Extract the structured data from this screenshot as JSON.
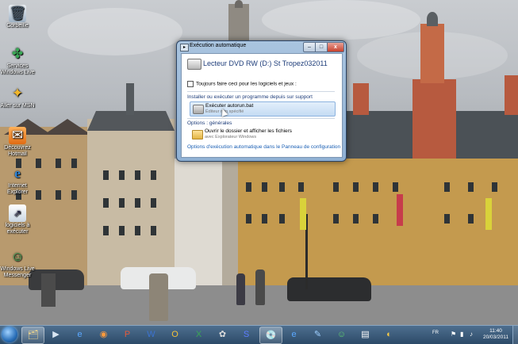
{
  "desktop": {
    "icons": [
      {
        "label": "Corbeille",
        "icon": "recycle-bin-icon"
      },
      {
        "label": "Services Windows Live",
        "icon": "windows-live-services-icon"
      },
      {
        "label": "Aller sur MSN",
        "icon": "msn-butterfly-icon"
      },
      {
        "label": "Découvrez Hotmail",
        "icon": "hotmail-icon"
      },
      {
        "label": "Internet Explorer",
        "icon": "internet-explorer-icon"
      },
      {
        "label": "logiciels à exécuter",
        "icon": "folder-shortcut-icon"
      },
      {
        "label": "Windows Live Messenger",
        "icon": "messenger-icon"
      }
    ]
  },
  "dialog": {
    "title": "Exécution automatique",
    "drive_title": "Lecteur DVD RW (D:) St Tropez032011",
    "always_checkbox_label": "Toujours faire ceci pour les logiciels et jeux :",
    "section_install": "Installer ou exécuter un programme depuis sur support",
    "option_run_main": "Exécuter autorun.bat",
    "option_run_sub": "Éditeur non spécifié",
    "section_general": "Options : générales",
    "option_folder_main": "Ouvrir le dossier et afficher les fichiers",
    "option_folder_sub": "avec Explorateur Windows",
    "control_panel_link": "Options d'exécution automatique dans le Panneau de configuration",
    "minimize_glyph": "–",
    "maximize_glyph": "□",
    "close_glyph": "x"
  },
  "taskbar": {
    "items": [
      {
        "icon": "windows-explorer-icon",
        "glyph": "🗂",
        "active": true
      },
      {
        "icon": "media-player-icon",
        "glyph": "▶",
        "active": false
      },
      {
        "icon": "internet-explorer-icon",
        "glyph": "e",
        "active": false
      },
      {
        "icon": "firefox-icon",
        "glyph": "◉",
        "active": false
      },
      {
        "icon": "powerpoint-icon",
        "glyph": "P",
        "active": false
      },
      {
        "icon": "word-icon",
        "glyph": "W",
        "active": false
      },
      {
        "icon": "outlook-icon",
        "glyph": "O",
        "active": false
      },
      {
        "icon": "excel-icon",
        "glyph": "X",
        "active": false
      },
      {
        "icon": "app-icon",
        "glyph": "✿",
        "active": false
      },
      {
        "icon": "security-icon",
        "glyph": "S",
        "active": false
      },
      {
        "icon": "autoplay-window-icon",
        "glyph": "💿",
        "active": true
      },
      {
        "icon": "internet-explorer-2-icon",
        "glyph": "e",
        "active": false
      },
      {
        "icon": "paint-icon",
        "glyph": "✎",
        "active": false
      },
      {
        "icon": "messenger-icon",
        "glyph": "☺",
        "active": false
      },
      {
        "icon": "document-icon",
        "glyph": "▤",
        "active": false
      },
      {
        "icon": "chat-icon",
        "glyph": "◐",
        "active": false
      }
    ],
    "language": "FR",
    "clock_time": "11:40",
    "clock_date": "20/03/2011",
    "tray_icons": [
      "flag-icon",
      "network-icon",
      "volume-icon"
    ]
  },
  "colors": {
    "dialog_link": "#1a5fb4",
    "dialog_heading": "#1e3d7a",
    "taskbar": "#2c4a68"
  }
}
